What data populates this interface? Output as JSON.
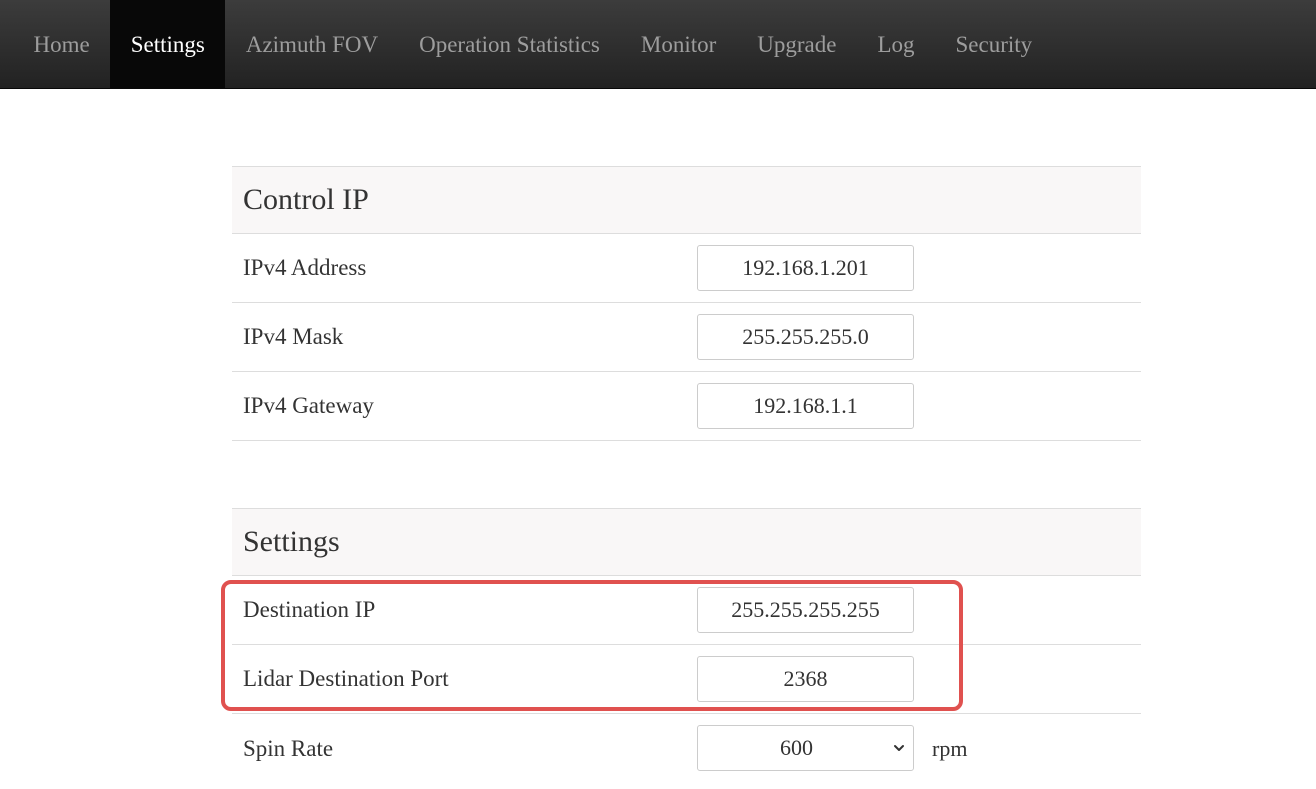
{
  "nav": {
    "items": [
      {
        "label": "Home"
      },
      {
        "label": "Settings"
      },
      {
        "label": "Azimuth FOV"
      },
      {
        "label": "Operation Statistics"
      },
      {
        "label": "Monitor"
      },
      {
        "label": "Upgrade"
      },
      {
        "label": "Log"
      },
      {
        "label": "Security"
      }
    ],
    "active": "Settings"
  },
  "control_ip": {
    "title": "Control IP",
    "rows": [
      {
        "label": "IPv4 Address",
        "value": "192.168.1.201"
      },
      {
        "label": "IPv4 Mask",
        "value": "255.255.255.0"
      },
      {
        "label": "IPv4 Gateway",
        "value": "192.168.1.1"
      }
    ]
  },
  "settings": {
    "title": "Settings",
    "rows": [
      {
        "label": "Destination IP",
        "value": "255.255.255.255"
      },
      {
        "label": "Lidar Destination Port",
        "value": "2368"
      }
    ],
    "spin_rate": {
      "label": "Spin Rate",
      "value": "600",
      "unit": "rpm"
    }
  },
  "colors": {
    "navbar": "#222222",
    "nav_active": "#080808",
    "panel_header": "#f9f7f7",
    "highlight": "#e0514f"
  }
}
